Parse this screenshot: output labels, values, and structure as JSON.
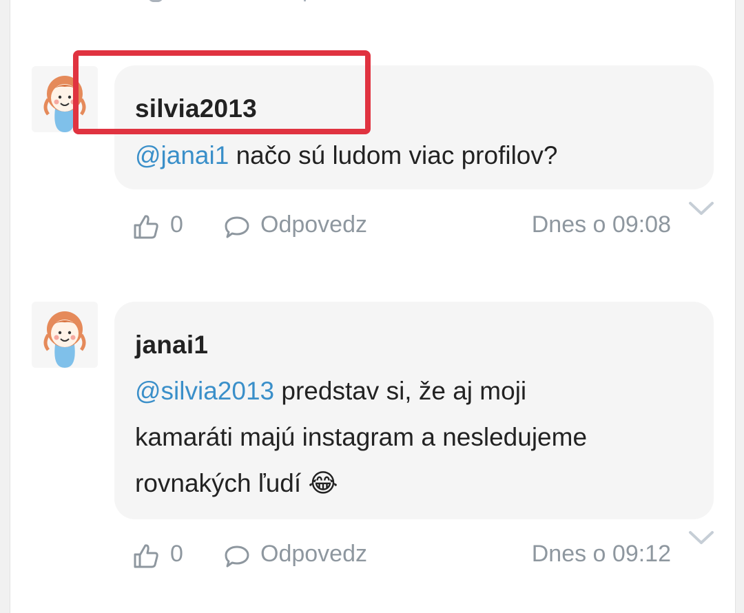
{
  "comments": [
    {
      "username": "silvia2013",
      "mention": "@janai1",
      "text": " načo sú ludom viac profilov?",
      "likes": "0",
      "reply_label": "Odpovedz",
      "time": "Dnes o 09:08"
    },
    {
      "username": "janai1",
      "mention": "@silvia2013",
      "text_line1": " predstav si, že aj moji",
      "text_line2": "kamaráti majú instagram a nesledujeme",
      "text_line3": "rovnakých ľudí ",
      "emoji": "😂",
      "likes": "0",
      "reply_label": "Odpovedz",
      "time": "Dnes o 09:12"
    }
  ],
  "colors": {
    "mention": "#3a8fc9",
    "highlight": "#e03340",
    "bubble": "#f5f5f5",
    "meta": "#8e979f"
  },
  "icons": [
    "thumbs-up-icon",
    "speech-bubble-icon",
    "chevron-down-icon"
  ]
}
